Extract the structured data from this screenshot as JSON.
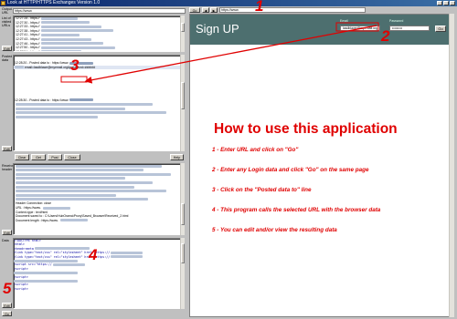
{
  "window": {
    "title": "Look at HTTP/HTTPS Exchanges Version 1.0"
  },
  "left": {
    "url_label": "Output URL",
    "url_value": "https://www.",
    "history_label": "List of visited URLs",
    "history_lines": [
      "12:27:28 - https://",
      "12:27:30 - https://",
      "12:27:33 - https://",
      "12:27:38 - https://",
      "12:27:41 - https://",
      "12:27:43 - https://",
      "12:27:46 - https://",
      "12:27:50 - https://",
      "12:27:54 - https://"
    ],
    "posted_label": "Posted data",
    "posted_lines": [
      "12:28:20 - Posted data to : https://www.",
      "email=lasdblawe@myemail.org&password=######"
    ],
    "posted_lines_2": [
      "12:28:30 - Posted data to : https://www."
    ],
    "buttons": {
      "clear": "Clear",
      "get": "Get",
      "post": "Post",
      "close": "Close",
      "help": "Help"
    },
    "header_label": "Received header",
    "header_lines": [
      "Header Connection: close",
      "",
      "URL : https://www.",
      "Content-type : text/html",
      "Document saved to : C:\\Users\\HubOrama\\Proxy\\Saved_Browser\\Received_2.html",
      "Document length : https://www."
    ],
    "data_label": "Data",
    "code_lines": [
      "<!DOCTYPE html>",
      "<html>",
      "<head><meta",
      "<link type=\"text/css\" rel=\"stylesheet\" href=\"https://",
      "<link type=\"text/css\" rel=\"stylesheet\" href=\"https://",
      "",
      "<script src=\"https://",
      "<script>",
      "",
      "<script>",
      "",
      "<script>",
      "<script>"
    ],
    "edit_label": "Edit",
    "go_label": "Go"
  },
  "browser_toolbar": {
    "back": "Go",
    "back_icon": "back-arrow",
    "fwd_icon": "forward-arrow",
    "url": "https://www."
  },
  "browser": {
    "signup_title": "Sign UP",
    "email_label": "Email",
    "email_value": "lasdblawe@myemail.org",
    "password_label": "Password",
    "password_value": "•••••••••",
    "go_label": "Go",
    "howto_title": "How to use this application",
    "steps": [
      "1 - Enter URL and click on \"Go\"",
      "2 - Enter any Login data and click \"Go\" on the same page",
      "3 - Click on the \"Posted data to\" line",
      "4 - This program calls the selected URL with the browser data",
      "5 - You can edit and/or view the resulting data"
    ]
  },
  "callouts": {
    "one": "1",
    "two": "2",
    "three": "3",
    "four": "4",
    "five": "5"
  },
  "colors": {
    "accent_red": "#e00000",
    "signup_bar": "#4d6f6f"
  }
}
